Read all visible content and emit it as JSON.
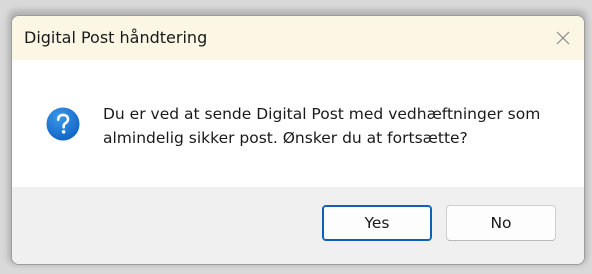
{
  "dialog": {
    "title": "Digital Post håndtering",
    "message": "Du er ved at sende Digital Post med vedhæftninger som almindelig sikker post. Ønsker du at fortsætte?",
    "icon": "question-icon",
    "close_icon": "close-icon",
    "buttons": {
      "yes_label": "Yes",
      "no_label": "No"
    },
    "colors": {
      "titlebar_bg": "#fbf7e4",
      "footer_bg": "#f0f0f0",
      "accent": "#0f5fb8",
      "icon_blue": "#1a78d6"
    }
  }
}
